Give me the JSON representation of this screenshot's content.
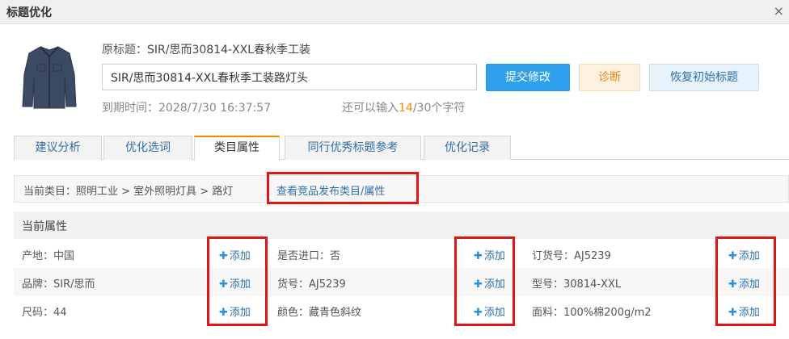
{
  "window": {
    "title": "标题优化",
    "close_glyph": "×"
  },
  "product": {
    "original_label": "原标题：",
    "original_title": "SIR/思而30814-XXL春秋季工装",
    "title_input_value": "SIR/思而30814-XXL春秋季工装路灯头",
    "expire_label": "到期时间：",
    "expire_time": "2028/7/30 16:37:57",
    "remain_prefix": "还可以输入",
    "remain_count": "14",
    "remain_suffix": "/30个字符",
    "image_icon": "jacket-photo"
  },
  "actions": {
    "submit_label": "提交修改",
    "diagnose_label": "诊断",
    "restore_label": "恢复初始标题"
  },
  "tabs": [
    {
      "label": "建议分析"
    },
    {
      "label": "优化选词"
    },
    {
      "label": "类目属性",
      "active": true
    },
    {
      "label": "同行优秀标题参考"
    },
    {
      "label": "优化记录"
    }
  ],
  "category": {
    "path": "当前类目：照明工业 > 室外照明灯具 > 路灯",
    "view_link": "查看竞品发布类目/属性"
  },
  "attributes": {
    "header": "当前属性",
    "add_label": "添加",
    "add_icon": "plus-icon",
    "rows": [
      [
        {
          "text": "产地：中国"
        },
        {
          "text": "是否进口：否"
        },
        {
          "text": "订货号：AJ5239"
        }
      ],
      [
        {
          "text": "品牌：SIR/思而"
        },
        {
          "text": "货号：AJ5239"
        },
        {
          "text": "型号：30814-XXL"
        }
      ],
      [
        {
          "text": "尺码：44"
        },
        {
          "text": "颜色：藏青色斜纹"
        },
        {
          "text": "面料：100%棉200g/m2"
        }
      ]
    ]
  },
  "colors": {
    "accent_blue": "#2ea0ec",
    "link_blue": "#2f6ea8",
    "orange": "#f08a00",
    "highlight_red": "#e01616"
  }
}
